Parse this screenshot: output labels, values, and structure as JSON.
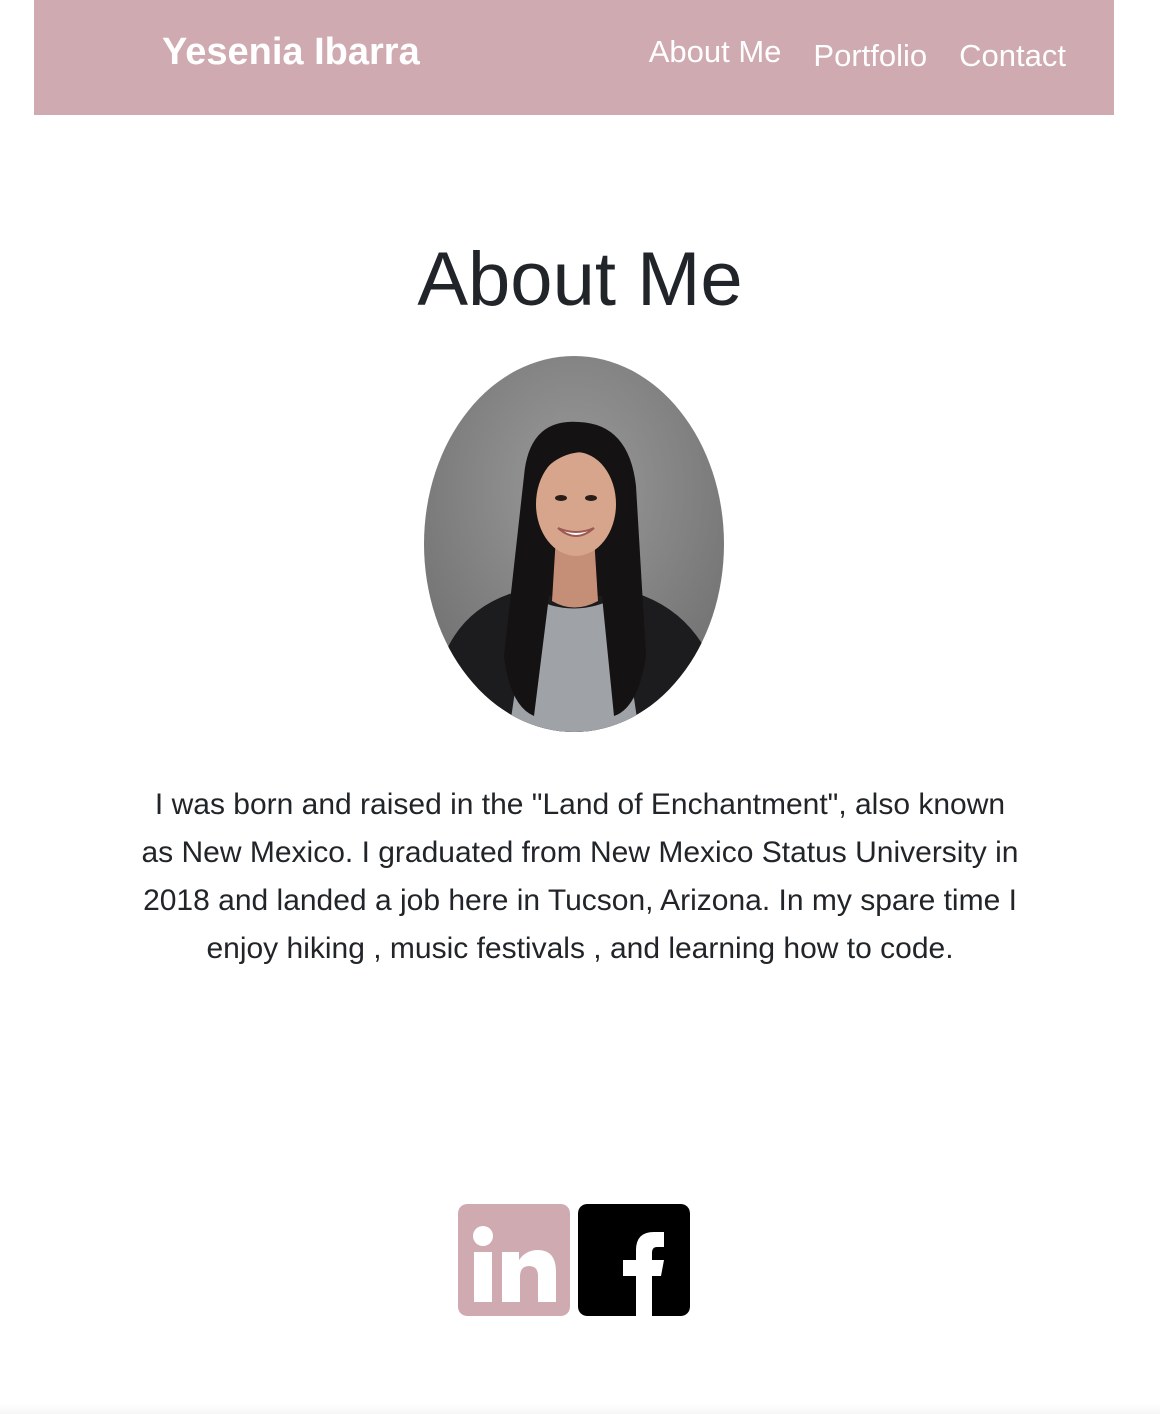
{
  "navbar": {
    "brand": "Yesenia Ibarra",
    "links": [
      {
        "label": "About Me"
      },
      {
        "label": "Portfolio"
      },
      {
        "label": "Contact"
      }
    ],
    "background_color": "#cfaab0",
    "text_color": "#ffffff"
  },
  "main": {
    "title": "About Me",
    "portrait_icon": "portrait-photo",
    "bio": "I was born and raised in the \"Land of Enchantment\", also known as New Mexico. I graduated from New Mexico Status University in 2018 and landed a job here in Tucson, Arizona. In my spare time I enjoy hiking , music festivals , and learning how to code."
  },
  "social": {
    "icons": [
      {
        "name": "linkedin-icon",
        "glyph": "in",
        "color": "#cfaab0"
      },
      {
        "name": "facebook-icon",
        "glyph": "f",
        "color": "#000000"
      }
    ]
  }
}
